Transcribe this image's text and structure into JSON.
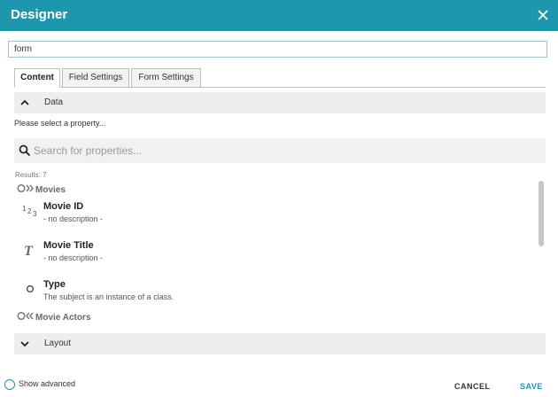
{
  "header": {
    "title": "Designer"
  },
  "form_name_input": {
    "value": "form"
  },
  "tabs": [
    {
      "label": "Content",
      "active": true
    },
    {
      "label": "Field Settings",
      "active": false
    },
    {
      "label": "Form Settings",
      "active": false
    }
  ],
  "data_section": {
    "label": "Data",
    "expanded": true
  },
  "hint": "Please select a property...",
  "search": {
    "placeholder": "Search for properties...",
    "value": ""
  },
  "results_count": "Results: 7",
  "groups": [
    {
      "label": "Movies",
      "icon": "outgoing-relation-icon"
    },
    {
      "label": "Movie Actors",
      "icon": "incoming-relation-icon"
    }
  ],
  "items": [
    {
      "name": "Movie ID",
      "description": "- no description -",
      "type_icon": "number-type-icon",
      "type_glyph": "1 2 3"
    },
    {
      "name": "Movie Title",
      "description": "- no description -",
      "type_icon": "text-type-icon",
      "type_glyph": "T"
    },
    {
      "name": "Type",
      "description": "The subject is an instance of a class.",
      "type_icon": "class-type-icon"
    }
  ],
  "layout_section": {
    "label": "Layout",
    "expanded": false
  },
  "footer": {
    "show_advanced_label": "Show advanced",
    "show_advanced_checked": false,
    "cancel_label": "CANCEL",
    "save_label": "SAVE"
  },
  "colors": {
    "accent": "#1e96ab",
    "section_bg": "#eceef0"
  }
}
